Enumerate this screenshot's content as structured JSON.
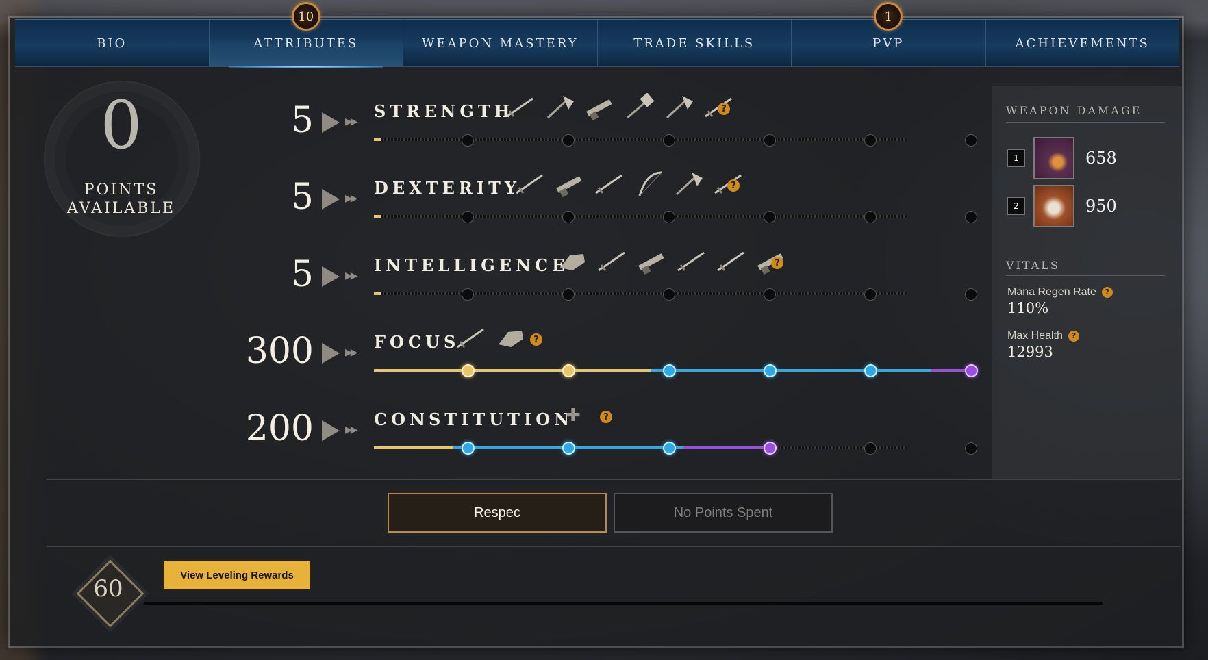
{
  "tabs": [
    {
      "label": "BIO",
      "badge": ""
    },
    {
      "label": "ATTRIBUTES",
      "badge": "10"
    },
    {
      "label": "WEAPON MASTERY",
      "badge": ""
    },
    {
      "label": "TRADE SKILLS",
      "badge": ""
    },
    {
      "label": "PVP",
      "badge": "1"
    },
    {
      "label": "ACHIEVEMENTS",
      "badge": ""
    }
  ],
  "active_tab": "ATTRIBUTES",
  "points": {
    "value": "0",
    "label_line1": "POINTS",
    "label_line2": "AVAILABLE"
  },
  "attributes": [
    {
      "name": "STRENGTH",
      "value": "5",
      "help": "?",
      "icons": [
        "sword-icon",
        "war-hammer-icon",
        "musket-icon",
        "hammer-icon",
        "hatchet-icon",
        "spear-icon"
      ],
      "milestones": [
        "none",
        "none",
        "none",
        "none",
        "none",
        "none"
      ],
      "fill": 0.01
    },
    {
      "name": "DEXTERITY",
      "value": "5",
      "help": "?",
      "icons": [
        "rapier-icon",
        "musket-icon",
        "spear-icon",
        "bow-icon",
        "hatchet-icon",
        "sword-icon"
      ],
      "milestones": [
        "none",
        "none",
        "none",
        "none",
        "none",
        "none"
      ],
      "fill": 0.01
    },
    {
      "name": "INTELLIGENCE",
      "value": "5",
      "help": "?",
      "icons": [
        "gauntlet-icon",
        "staff-icon",
        "blunderbuss-icon",
        "spear-icon",
        "rapier-icon",
        "musket-icon"
      ],
      "milestones": [
        "none",
        "none",
        "none",
        "none",
        "none",
        "none"
      ],
      "fill": 0.01
    },
    {
      "name": "FOCUS",
      "value": "300",
      "help": "?",
      "icons": [
        "life-staff-icon",
        "void-gauntlet-icon"
      ],
      "milestones": [
        "gold",
        "gold",
        "blue",
        "blue",
        "blue",
        "purple"
      ],
      "fill": 1.0
    },
    {
      "name": "CONSTITUTION",
      "value": "200",
      "help": "?",
      "plus": "✚",
      "icons": [],
      "milestones": [
        "blue",
        "blue",
        "blue",
        "purple",
        "none",
        "none"
      ],
      "fill": 0.66
    }
  ],
  "side": {
    "weapon_damage_title": "WEAPON DAMAGE",
    "weapons": [
      {
        "slot": "1",
        "damage": "658",
        "icon": "void-gauntlet-icon"
      },
      {
        "slot": "2",
        "damage": "950",
        "icon": "life-staff-icon"
      }
    ],
    "vitals_title": "VITALS",
    "vitals": [
      {
        "label": "Mana Regen Rate",
        "value": "110%",
        "help": "?"
      },
      {
        "label": "Max Health",
        "value": "12993",
        "help": "?"
      }
    ]
  },
  "buttons": {
    "respec": "Respec",
    "no_points": "No Points Spent"
  },
  "level": {
    "value": "60",
    "rewards_button": "View Leveling Rewards"
  },
  "colors": {
    "gold": "#e9c66a",
    "blue": "#2fa8e6",
    "purple": "#9a4fe0",
    "accent": "#e7b23a"
  }
}
